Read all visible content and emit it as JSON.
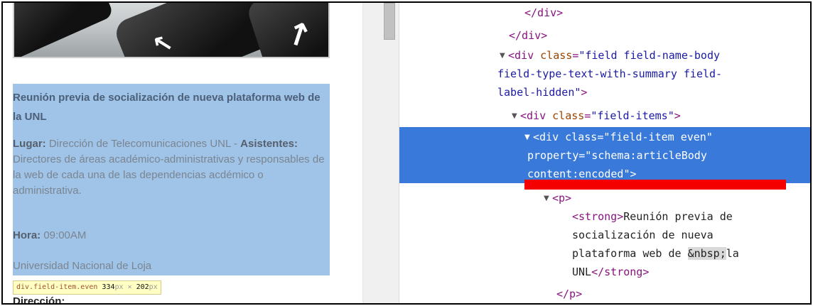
{
  "left_page": {
    "title": "Reunión previa de socialización de nueva plataforma web de  la UNL",
    "lugar_label": "Lugar:",
    "lugar_value": " Dirección de Telecomunicaciones UNL - ",
    "asistentes_label": "Asistentes:",
    "asistentes_value": " Directores de áreas académico-administrativas y responsables de la web de cada una de las dependencias acdémico o administrativa.",
    "hora_label": "Hora:",
    "hora_value": " 09:00AM",
    "universidad": "Universidad Nacional de Loja",
    "direccion_label": "Dirección:",
    "tooltip": {
      "selector": "div.field-item.even",
      "width": "334",
      "height": "202",
      "unit": "px",
      "times": " × "
    }
  },
  "devtools": {
    "close_div": "</div>",
    "body_div_tag": "<div ",
    "attr_class": "class",
    "attr_eq": "=",
    "body_class_part1": "\"field field-name-body",
    "body_class_part2": "field-type-text-with-summary field-",
    "body_class_part3": "label-hidden\"",
    "gt": ">",
    "items_class": "\"field-items\"",
    "item_class": "\"field-item even\"",
    "attr_property": "property",
    "property_part1": "\"schema:articleBody",
    "property_part2": "content:encoded\"",
    "p_open": "<p>",
    "p_close": "</p>",
    "strong_open": "<strong>",
    "strong_close": "</strong>",
    "strong_text1": "Reunión previa de",
    "strong_text2": "socialización de nueva",
    "strong_text3": "plataforma web de ",
    "nbsp": "&nbsp;",
    "strong_text4a": "la",
    "strong_text5": "UNL",
    "expanded_triangle": "▼",
    "highlight_color": "#3879d9",
    "annotation_color": "#f40000"
  }
}
